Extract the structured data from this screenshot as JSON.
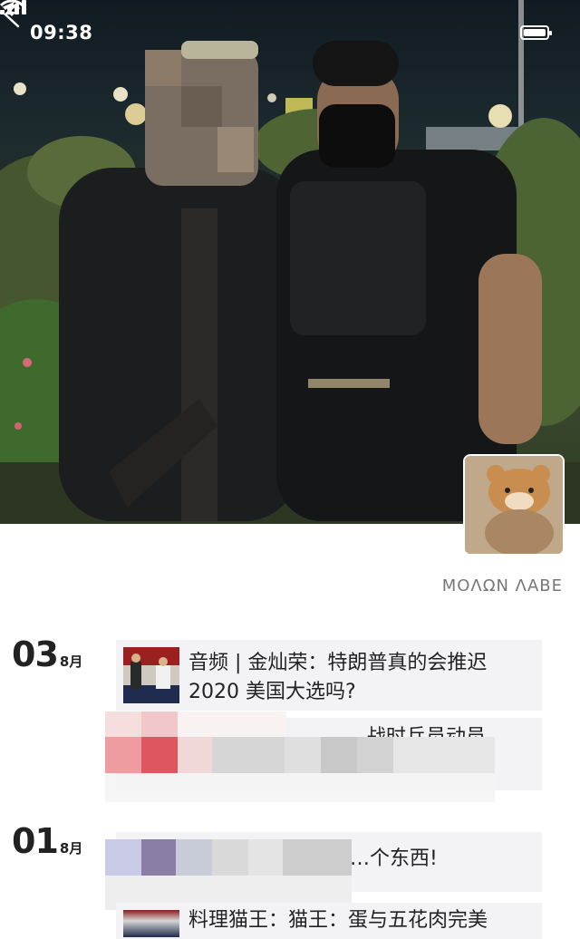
{
  "status_bar": {
    "time": "09:38"
  },
  "profile": {
    "signature": "ΜΟΛΩΝ ΛΑΒΕ"
  },
  "timeline": [
    {
      "day": "03",
      "month": "8月",
      "posts": [
        {
          "type": "shared-article",
          "title": "音频 | 金灿荣：特朗普真的会推迟 2020 美国大选吗?"
        },
        {
          "type": "text",
          "text": "…战时兵员动员，"
        }
      ]
    },
    {
      "day": "01",
      "month": "8月",
      "posts": [
        {
          "type": "text",
          "text": "…个东西!"
        },
        {
          "type": "shared-article",
          "title": "料理猫王：猫王：蛋与五花肉完美"
        }
      ]
    }
  ]
}
